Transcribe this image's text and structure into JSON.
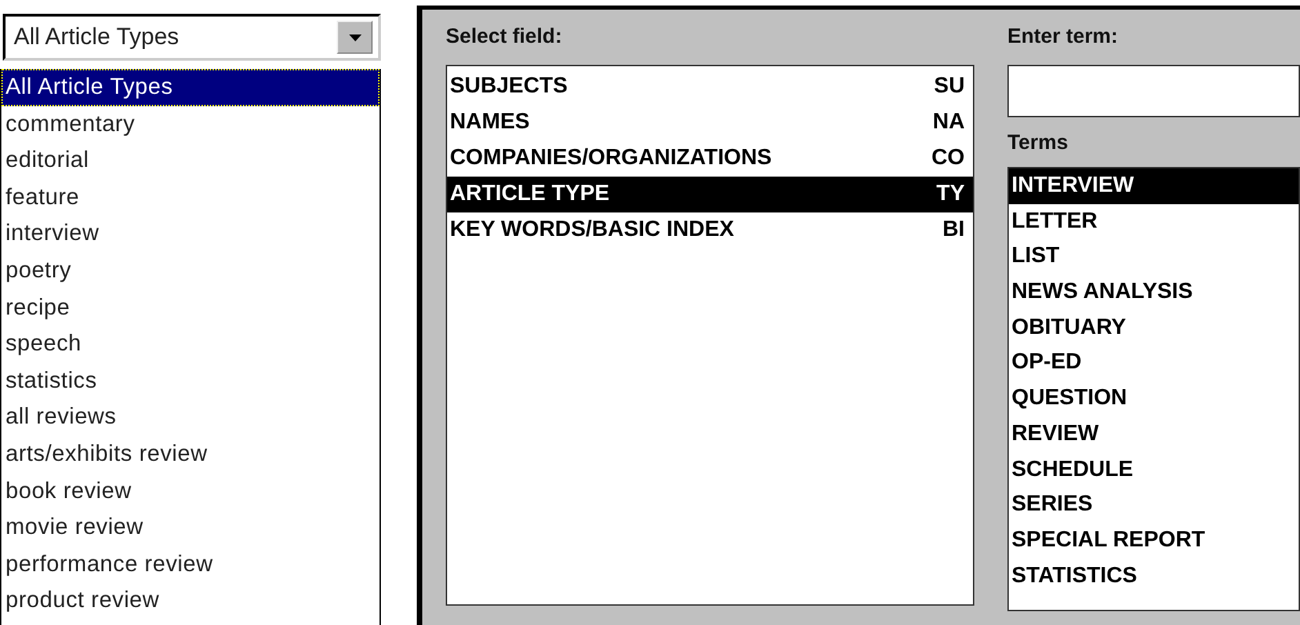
{
  "article_type_dropdown": {
    "value": "All Article Types",
    "options": [
      {
        "label": "All Article Types",
        "selected": true
      },
      {
        "label": "commentary",
        "selected": false
      },
      {
        "label": "editorial",
        "selected": false
      },
      {
        "label": "feature",
        "selected": false
      },
      {
        "label": "interview",
        "selected": false
      },
      {
        "label": "poetry",
        "selected": false
      },
      {
        "label": "recipe",
        "selected": false
      },
      {
        "label": "speech",
        "selected": false
      },
      {
        "label": "statistics",
        "selected": false
      },
      {
        "label": "all reviews",
        "selected": false
      },
      {
        "label": "arts/exhibits review",
        "selected": false
      },
      {
        "label": "book review",
        "selected": false
      },
      {
        "label": "movie review",
        "selected": false
      },
      {
        "label": "performance review",
        "selected": false
      },
      {
        "label": "product review",
        "selected": false
      }
    ]
  },
  "search_panel": {
    "select_field_label": "Select field:",
    "fields": [
      {
        "name": "SUBJECTS",
        "code": "SU",
        "selected": false
      },
      {
        "name": "NAMES",
        "code": "NA",
        "selected": false
      },
      {
        "name": "COMPANIES/ORGANIZATIONS",
        "code": "CO",
        "selected": false
      },
      {
        "name": "ARTICLE TYPE",
        "code": "TY",
        "selected": true
      },
      {
        "name": "KEY WORDS/BASIC INDEX",
        "code": "BI",
        "selected": false
      }
    ],
    "enter_term_label": "Enter term:",
    "terms_label": "Terms",
    "terms": [
      {
        "label": "INTERVIEW",
        "selected": true
      },
      {
        "label": "LETTER",
        "selected": false
      },
      {
        "label": "LIST",
        "selected": false
      },
      {
        "label": "NEWS ANALYSIS",
        "selected": false
      },
      {
        "label": "OBITUARY",
        "selected": false
      },
      {
        "label": "OP-ED",
        "selected": false
      },
      {
        "label": "QUESTION",
        "selected": false
      },
      {
        "label": "REVIEW",
        "selected": false
      },
      {
        "label": "SCHEDULE",
        "selected": false
      },
      {
        "label": "SERIES",
        "selected": false
      },
      {
        "label": "SPECIAL REPORT",
        "selected": false
      },
      {
        "label": "STATISTICS",
        "selected": false
      }
    ]
  }
}
